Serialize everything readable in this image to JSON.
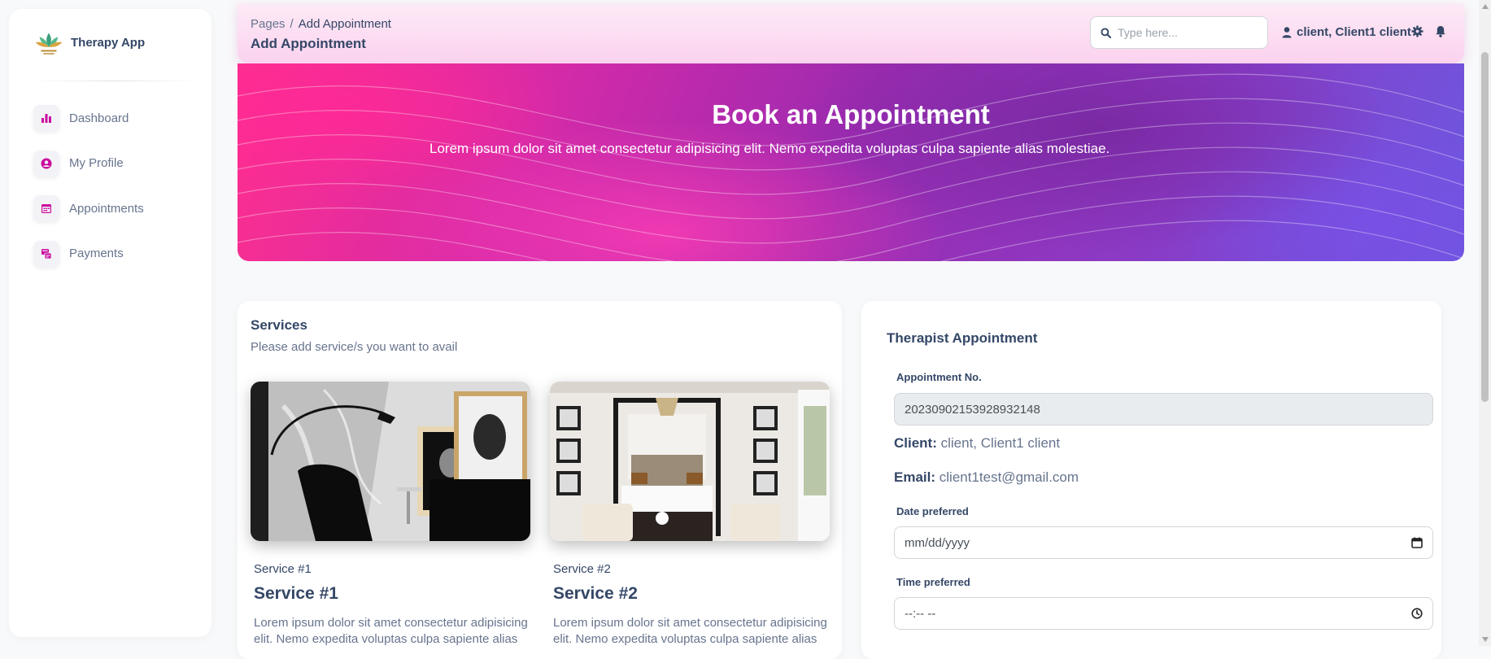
{
  "sidebar": {
    "brand_name": "Therapy App",
    "items": [
      {
        "label": "Dashboard",
        "icon": "bar-chart-icon"
      },
      {
        "label": "My Profile",
        "icon": "user-circle-icon"
      },
      {
        "label": "Appointments",
        "icon": "calendar-icon"
      },
      {
        "label": "Payments",
        "icon": "payment-icon"
      }
    ]
  },
  "header": {
    "breadcrumb_root": "Pages",
    "breadcrumb_separator": "/",
    "breadcrumb_current": "Add Appointment",
    "title": "Add Appointment",
    "search_placeholder": "Type here...",
    "user_name": "client, Client1 client"
  },
  "hero": {
    "title": "Book an Appointment",
    "subtitle": "Lorem ipsum dolor sit amet consectetur adipisicing elit. Nemo expedita voluptas culpa sapiente alias molestiae."
  },
  "services": {
    "title": "Services",
    "subtitle": "Please add service/s you want to avail",
    "items": [
      {
        "kicker": "Service #1",
        "name": "Service #1",
        "description": "Lorem ipsum dolor sit amet consectetur adipisicing elit. Nemo expedita voluptas culpa sapiente alias"
      },
      {
        "kicker": "Service #2",
        "name": "Service #2",
        "description": "Lorem ipsum dolor sit amet consectetur adipisicing elit. Nemo expedita voluptas culpa sapiente alias"
      }
    ]
  },
  "appointment": {
    "title": "Therapist Appointment",
    "number_label": "Appointment No.",
    "number_value": "20230902153928932148",
    "client_label": "Client:",
    "client_value": "client, Client1 client",
    "email_label": "Email:",
    "email_value": "client1test@gmail.com",
    "date_label": "Date preferred",
    "date_placeholder": "mm/dd/yyyy",
    "time_label": "Time preferred",
    "time_placeholder": "--:-- --"
  },
  "colors": {
    "accent": "#cb0c9f",
    "text_dark": "#344767",
    "text_muted": "#67748e"
  }
}
